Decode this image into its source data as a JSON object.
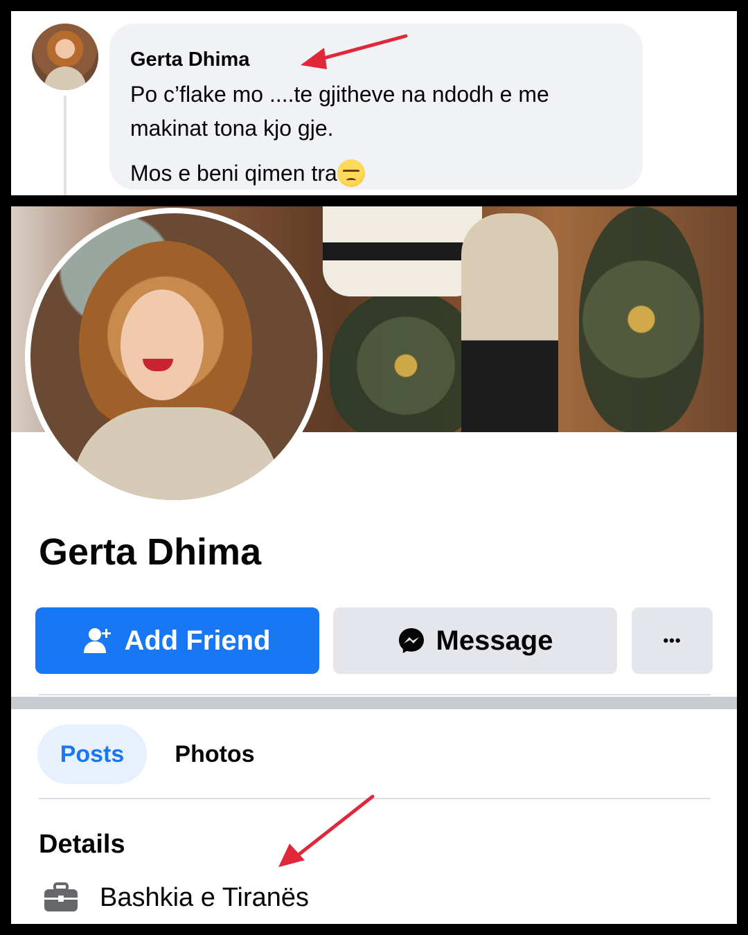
{
  "comment": {
    "author": "Gerta Dhima",
    "line1": "Po c’flake mo ....te gjitheve na ndodh e me",
    "line2": "makinat tona kjo gje.",
    "line3": "Mos e beni qimen tra",
    "emoji": "unamused-face"
  },
  "profile": {
    "name": "Gerta Dhima",
    "add_friend_label": "Add Friend",
    "message_label": "Message",
    "more_label": "•••",
    "tabs": [
      {
        "label": "Posts",
        "active": true
      },
      {
        "label": "Photos",
        "active": false
      }
    ],
    "details_title": "Details",
    "work": "Bashkia e Tiranës"
  },
  "icons": {
    "add_friend": "add-friend-icon",
    "message": "messenger-icon",
    "work": "briefcase-icon",
    "annotation": "red-arrow"
  },
  "colors": {
    "primary": "#1877f2",
    "secondary_button": "#e4e6eb",
    "active_tab_bg": "#e7f0fd",
    "bubble": "#f0f2f5",
    "arrow": "#e0283a",
    "text": "#050505"
  }
}
